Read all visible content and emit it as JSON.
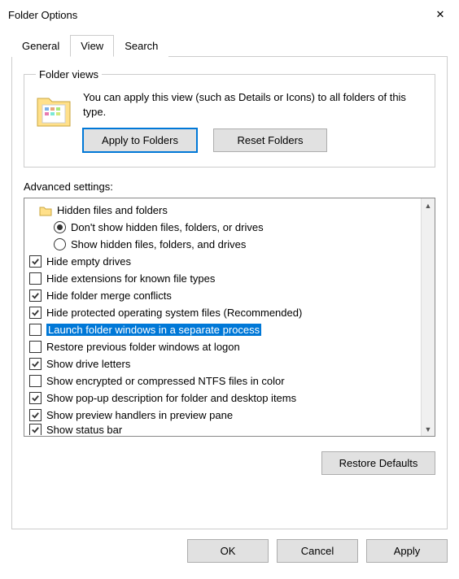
{
  "window": {
    "title": "Folder Options"
  },
  "tabs": {
    "general": "General",
    "view": "View",
    "search": "Search",
    "active": "view"
  },
  "folder_views": {
    "legend": "Folder views",
    "text": "You can apply this view (such as Details or Icons) to all folders of this type.",
    "apply": "Apply to Folders",
    "reset": "Reset Folders"
  },
  "advanced": {
    "label": "Advanced settings:",
    "items": [
      {
        "type": "header",
        "indent": 12,
        "label": "Hidden files and folders"
      },
      {
        "type": "radio",
        "indent": 30,
        "checked": true,
        "label": "Don't show hidden files, folders, or drives"
      },
      {
        "type": "radio",
        "indent": 30,
        "checked": false,
        "label": "Show hidden files, folders, and drives"
      },
      {
        "type": "check",
        "indent": 0,
        "checked": true,
        "label": "Hide empty drives"
      },
      {
        "type": "check",
        "indent": 0,
        "checked": false,
        "label": "Hide extensions for known file types"
      },
      {
        "type": "check",
        "indent": 0,
        "checked": true,
        "label": "Hide folder merge conflicts"
      },
      {
        "type": "check",
        "indent": 0,
        "checked": true,
        "label": "Hide protected operating system files (Recommended)"
      },
      {
        "type": "check",
        "indent": 0,
        "checked": false,
        "label": "Launch folder windows in a separate process",
        "selected": true
      },
      {
        "type": "check",
        "indent": 0,
        "checked": false,
        "label": "Restore previous folder windows at logon"
      },
      {
        "type": "check",
        "indent": 0,
        "checked": true,
        "label": "Show drive letters"
      },
      {
        "type": "check",
        "indent": 0,
        "checked": false,
        "label": "Show encrypted or compressed NTFS files in color"
      },
      {
        "type": "check",
        "indent": 0,
        "checked": true,
        "label": "Show pop-up description for folder and desktop items"
      },
      {
        "type": "check",
        "indent": 0,
        "checked": true,
        "label": "Show preview handlers in preview pane"
      },
      {
        "type": "check",
        "indent": 0,
        "checked": true,
        "label": "Show status bar",
        "cut": true
      }
    ],
    "restore": "Restore Defaults"
  },
  "buttons": {
    "ok": "OK",
    "cancel": "Cancel",
    "apply": "Apply"
  }
}
